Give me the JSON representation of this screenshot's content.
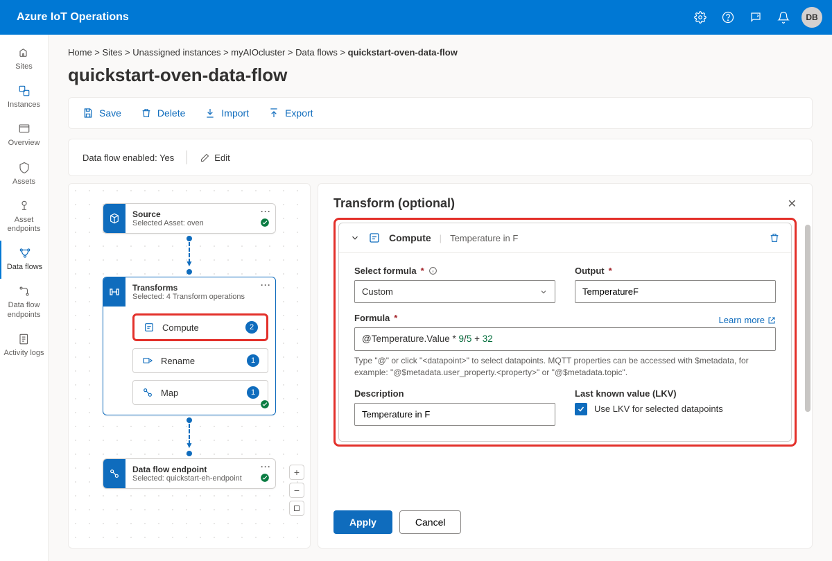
{
  "header": {
    "brand": "Azure IoT Operations",
    "avatar_initials": "DB"
  },
  "sidenav": {
    "items": [
      {
        "id": "sites",
        "label": "Sites"
      },
      {
        "id": "instances",
        "label": "Instances"
      },
      {
        "id": "overview",
        "label": "Overview"
      },
      {
        "id": "assets",
        "label": "Assets"
      },
      {
        "id": "asset-endpoints",
        "label": "Asset endpoints"
      },
      {
        "id": "data-flows",
        "label": "Data flows"
      },
      {
        "id": "data-flow-endpoints",
        "label": "Data flow endpoints"
      },
      {
        "id": "activity-logs",
        "label": "Activity logs"
      }
    ],
    "selected": "data-flows"
  },
  "breadcrumb": {
    "items": [
      "Home",
      "Sites",
      "Unassigned instances",
      "myAIOcluster",
      "Data flows",
      "quickstart-oven-data-flow"
    ]
  },
  "page_title": "quickstart-oven-data-flow",
  "toolbar": {
    "save": "Save",
    "delete": "Delete",
    "import": "Import",
    "export": "Export"
  },
  "status": {
    "label": "Data flow enabled:",
    "value": "Yes",
    "edit": "Edit"
  },
  "canvas": {
    "source": {
      "title": "Source",
      "subtitle": "Selected Asset: oven"
    },
    "transforms": {
      "title": "Transforms",
      "subtitle": "Selected: 4 Transform operations",
      "chips": [
        {
          "id": "compute",
          "label": "Compute",
          "count": "2",
          "hl": true
        },
        {
          "id": "rename",
          "label": "Rename",
          "count": "1",
          "hl": false
        },
        {
          "id": "map",
          "label": "Map",
          "count": "1",
          "hl": false
        }
      ]
    },
    "endpoint": {
      "title": "Data flow endpoint",
      "subtitle": "Selected: quickstart-eh-endpoint"
    }
  },
  "panel": {
    "title": "Transform (optional)",
    "block": {
      "name": "Compute",
      "subtitle": "Temperature in F"
    },
    "fields": {
      "formula_select": {
        "label": "Select formula",
        "value": "Custom"
      },
      "output": {
        "label": "Output",
        "value": "TemperatureF"
      },
      "formula": {
        "label": "Formula",
        "learn": "Learn more",
        "value_pre": "@Temperature.Value * ",
        "value_n1": "9",
        "value_mid": "/",
        "value_n2": "5",
        "value_mid2": " + ",
        "value_n3": "32",
        "hint": "Type \"@\" or click \"<datapoint>\" to select datapoints. MQTT properties can be accessed with $metadata, for example: \"@$metadata.user_property.<property>\" or \"@$metadata.topic\"."
      },
      "description": {
        "label": "Description",
        "value": "Temperature in F"
      },
      "lkv": {
        "label": "Last known value (LKV)",
        "checkbox": "Use LKV for selected datapoints",
        "checked": true
      }
    },
    "footer": {
      "apply": "Apply",
      "cancel": "Cancel"
    }
  }
}
